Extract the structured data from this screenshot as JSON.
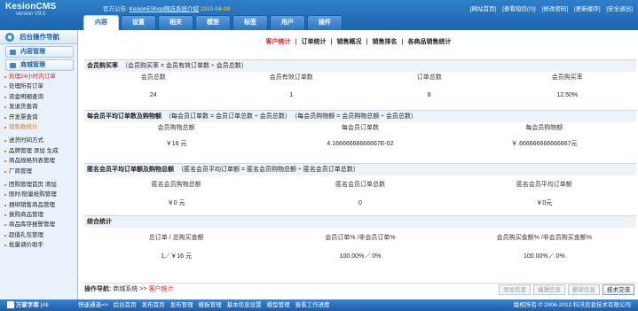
{
  "header": {
    "logo_title": "KesionCMS",
    "logo_version": "version V9.0",
    "notice_label": "官方公告:",
    "notice_link": "KesionEShop网店系统介绍",
    "notice_date": "2010-04-08",
    "links": [
      "[网站首页]",
      "[查看短信(0)]",
      "[修改密码]",
      "[更新缓存]",
      "[安全退出]"
    ]
  },
  "tabs": [
    "内容",
    "设置",
    "相关",
    "模型",
    "标签",
    "用户",
    "插件"
  ],
  "sidebar": {
    "title": "后台操作导航",
    "groups": [
      "内容管理",
      "商城管理"
    ],
    "items": [
      {
        "label": "处理24小时内订单",
        "color": "red"
      },
      {
        "label": "处理所有订单",
        "color": ""
      },
      {
        "label": "资金明细查询",
        "color": ""
      },
      {
        "label": "发退货查询",
        "color": ""
      },
      {
        "label": "开发票查询",
        "color": ""
      },
      {
        "label": "销售数统计",
        "color": "orange"
      },
      {
        "label": "",
        "color": "sep"
      },
      {
        "label": "送货时间方式",
        "color": ""
      },
      {
        "label": "品牌管理 添加 生成",
        "color": ""
      },
      {
        "label": "商品规格列表管理",
        "color": ""
      },
      {
        "label": "厂商管理",
        "color": ""
      },
      {
        "label": "",
        "color": "sep"
      },
      {
        "label": "团购管理首页 添加",
        "color": ""
      },
      {
        "label": "限时/限量抢购管理",
        "color": ""
      },
      {
        "label": "捆绑销售商品管理",
        "color": ""
      },
      {
        "label": "换购商品管理",
        "color": ""
      },
      {
        "label": "商品库存报警管理",
        "color": ""
      },
      {
        "label": "超值礼包管理",
        "color": ""
      },
      {
        "label": "批量调价助手",
        "color": ""
      }
    ]
  },
  "subnav": {
    "items": [
      "客户统计",
      "订单统计",
      "销售概况",
      "销售排名",
      "各商品销售统计"
    ],
    "current": "客户统计"
  },
  "sections": {
    "s1": {
      "title": "会员购买率",
      "note": "（会员购买率 = 会员有效订单数 ÷ 会员总数）",
      "headers": [
        "会员总数",
        "会员有效订单数",
        "订单总数",
        "会员购买率"
      ],
      "values": [
        "24",
        "1",
        "8",
        "12.50%"
      ]
    },
    "s2": {
      "title": "每会员平均订单数及购物额",
      "note1": "（每会员订单数 = 会员订单总数 ÷ 会员总数）",
      "note2": "（每会员购物额 = 会员购物总额 ÷ 会员总数）",
      "headers": [
        "会员购物总额",
        "每会员订单数",
        "每会员购物额"
      ],
      "values": [
        "￥16 元",
        "4.16666666666667E-02",
        "￥.666666666666667元"
      ]
    },
    "s3": {
      "title": "匿名会员平均订单额及购物总额",
      "note": "（匿名会员平均订单额 = 匿名会员购物总额 ÷ 匿名会员订单总数）",
      "headers": [
        "匿名会员购物总额",
        "匿名会员订单总数",
        "匿名会员平均订单额"
      ],
      "values": [
        "￥0 元",
        "0",
        "￥0元"
      ]
    },
    "s4": {
      "title": "综合统计",
      "headers": [
        "总订单 / 总购买金额",
        "会员订单% /非会员订单%",
        "会员购买金额% /非会员购买金额%"
      ],
      "values": [
        "1／￥16 元",
        "100.00%／ 0%",
        "100.00%／ 0%"
      ]
    }
  },
  "opbar": {
    "label": "操作导航:",
    "path": "商城系统 >>",
    "current": "客户统计",
    "buttons": [
      "添加信息",
      "编辑信息",
      "删除信息",
      "技术交流"
    ]
  },
  "footer": {
    "left": "万家字库",
    "left2": "|All",
    "nav": [
      "快速通道=>",
      "后台首页",
      "发布首页",
      "发布管理",
      "模板管理",
      "基本信息设置",
      "模型管理",
      "查看工作进度"
    ],
    "copyright": "版权所有 © 2006-2012 科汛信息技术有限公司"
  }
}
